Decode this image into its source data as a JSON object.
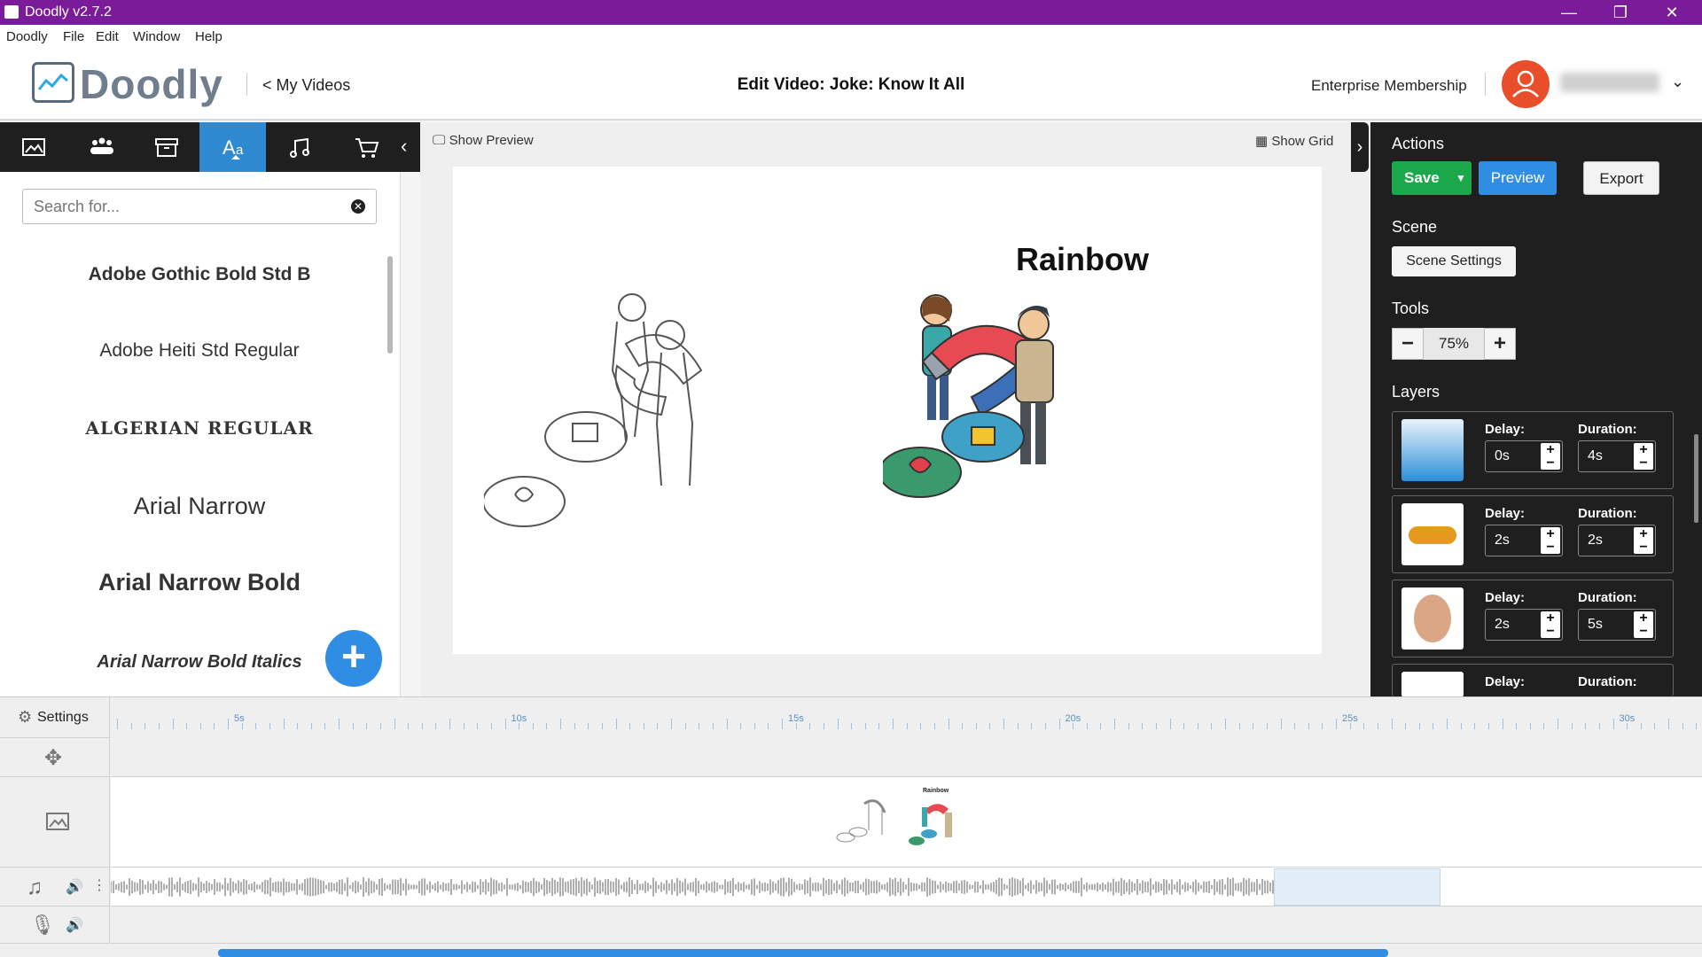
{
  "window": {
    "title": "Doodly v2.7.2",
    "controls": [
      "—",
      "❐",
      "✕"
    ]
  },
  "menu": [
    "Doodly",
    "File",
    "Edit",
    "Window",
    "Help"
  ],
  "header": {
    "logo_text": "Doodly",
    "back_link": "< My Videos",
    "page_title": "Edit Video: Joke: Know It All",
    "membership": "Enterprise Membership",
    "user_menu_icon": "chevron-down-icon"
  },
  "left_toolbar": {
    "tabs": [
      "image-icon",
      "characters-icon",
      "props-icon",
      "text-icon",
      "music-icon",
      "cart-icon"
    ],
    "active_tab": "text-icon"
  },
  "search": {
    "placeholder": "Search for..."
  },
  "fonts": [
    "Adobe Gothic Bold Std B",
    "Adobe Heiti Std Regular",
    "ALGERIAN REGULAR",
    "Arial Narrow",
    "Arial Narrow Bold",
    "Arial Narrow Bold Italics"
  ],
  "canvas": {
    "show_preview": "Show Preview",
    "show_grid": "Show Grid",
    "scene_text": "Rainbow"
  },
  "actions": {
    "heading": "Actions",
    "save": "Save",
    "preview": "Preview",
    "export": "Export",
    "scene_heading": "Scene",
    "scene_settings": "Scene Settings",
    "tools_heading": "Tools",
    "zoom": "75%",
    "zoom_minus": "−",
    "zoom_plus": "+",
    "layers_heading": "Layers"
  },
  "layers": [
    {
      "delay_label": "Delay:",
      "delay": "0s",
      "duration_label": "Duration:",
      "duration": "4s"
    },
    {
      "delay_label": "Delay:",
      "delay": "2s",
      "duration_label": "Duration:",
      "duration": "2s"
    },
    {
      "delay_label": "Delay:",
      "delay": "2s",
      "duration_label": "Duration:",
      "duration": "5s"
    },
    {
      "delay_label": "Delay:",
      "delay": "",
      "duration_label": "Duration:",
      "duration": ""
    }
  ],
  "timeline": {
    "settings_label": "Settings",
    "ruler_labels": [
      "5s",
      "10s",
      "15s",
      "20s",
      "25s",
      "30s"
    ],
    "thumb_text": "Rainbow"
  },
  "colors": {
    "titlebar": "#7a1c99",
    "save": "#1aa84a",
    "preview": "#2f8de4",
    "active_tab": "#2f8ad1",
    "avatar": "#e94e2a"
  }
}
